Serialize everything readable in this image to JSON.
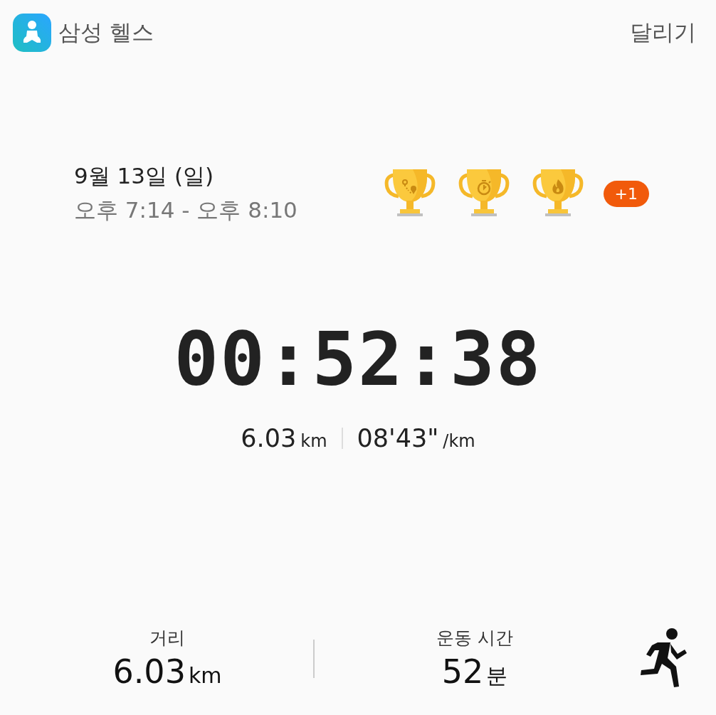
{
  "app": {
    "name": "삼성 헬스",
    "activity": "달리기"
  },
  "session": {
    "date": "9월 13일 (일)",
    "time_range": "오후 7:14 - 오후 8:10"
  },
  "trophies": [
    {
      "kind": "route"
    },
    {
      "kind": "stopwatch"
    },
    {
      "kind": "flame"
    }
  ],
  "more_trophies": "+1",
  "timer": "00:52:38",
  "summary": [
    {
      "value": "6.03",
      "unit": "km"
    },
    {
      "value": "08'43\"",
      "unit": "/km"
    }
  ],
  "stats": [
    {
      "label": "거리",
      "value": "6.03",
      "unit": "km"
    },
    {
      "label": "운동 시간",
      "value": "52",
      "unit": "분"
    }
  ]
}
